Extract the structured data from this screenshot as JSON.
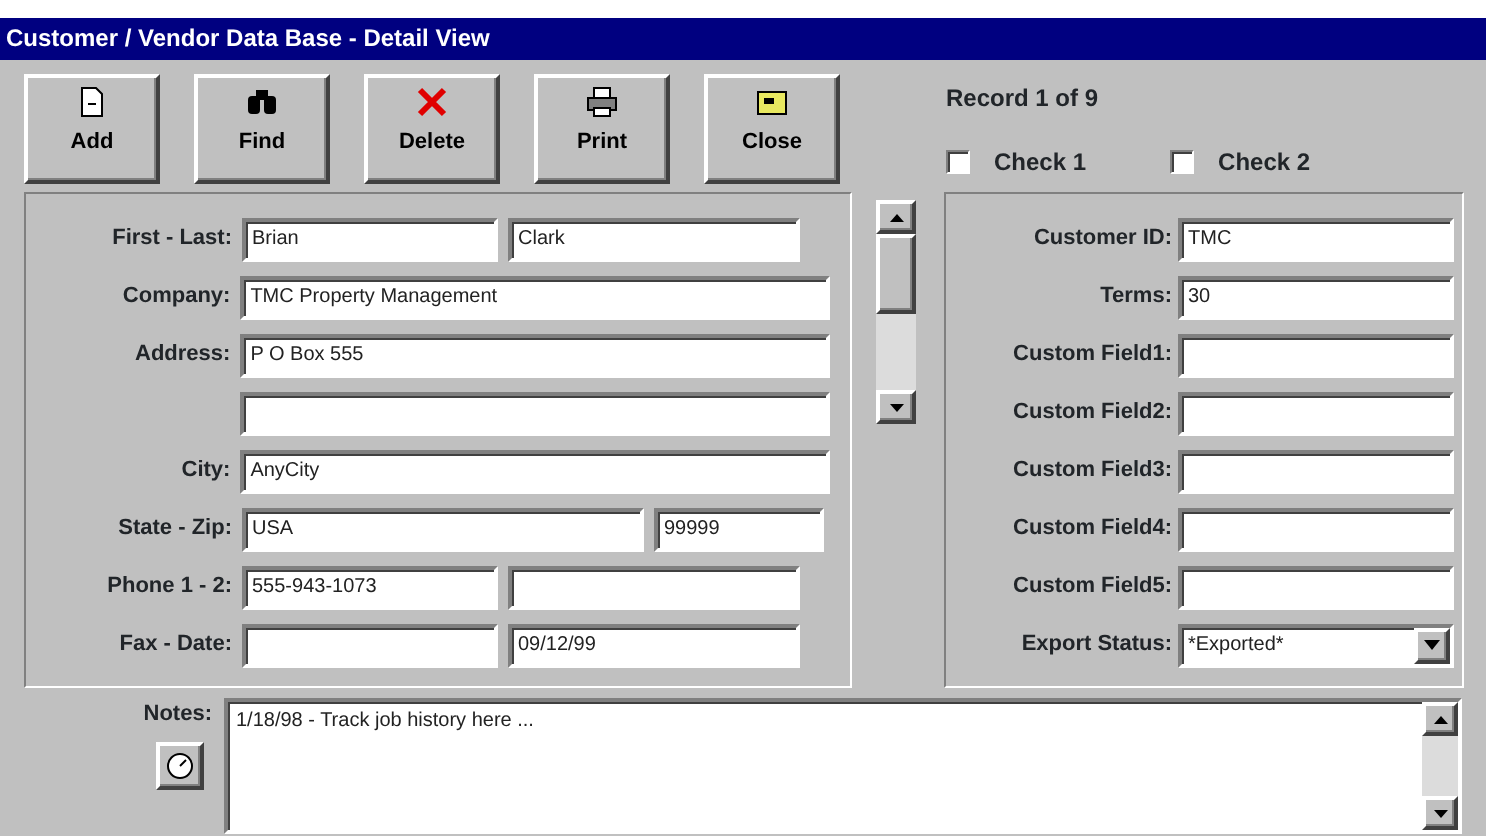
{
  "window": {
    "title": "Customer / Vendor Data Base - Detail View"
  },
  "toolbar": [
    {
      "label": "Add"
    },
    {
      "label": "Find"
    },
    {
      "label": "Delete"
    },
    {
      "label": "Print"
    },
    {
      "label": "Close"
    }
  ],
  "record": "Record 1 of 9",
  "checks": [
    {
      "label": "Check 1",
      "checked": false
    },
    {
      "label": "Check 2",
      "checked": false
    }
  ],
  "contact_fields": [
    {
      "label": "First - Last:",
      "kind": "pair",
      "fields": [
        {
          "kind": "text",
          "value": "Brian"
        },
        {
          "kind": "text",
          "value": "Clark"
        }
      ]
    },
    {
      "label": "Company:",
      "kind": "single",
      "fields": [
        {
          "kind": "text",
          "value": "TMC Property Management"
        }
      ]
    },
    {
      "label": "Address:",
      "kind": "single",
      "fields": [
        {
          "kind": "text",
          "value": "P O Box 555"
        }
      ]
    },
    {
      "kind": "single",
      "fields": [
        {
          "kind": "text"
        }
      ]
    },
    {
      "label": "City:",
      "kind": "single",
      "fields": [
        {
          "kind": "text",
          "value": "AnyCity"
        }
      ]
    },
    {
      "label": "State - Zip:",
      "kind": "wide_pair",
      "fields": [
        {
          "kind": "text",
          "value": "USA"
        },
        {
          "kind": "text",
          "value": "99999"
        }
      ]
    },
    {
      "label": "Phone 1 - 2:",
      "kind": "pair",
      "fields": [
        {
          "kind": "text",
          "value": "555-943-1073"
        },
        {
          "kind": "text"
        }
      ]
    },
    {
      "label": "Fax - Date:",
      "kind": "pair",
      "fields": [
        {
          "kind": "text"
        },
        {
          "kind": "text",
          "value": "09/12/99"
        }
      ]
    }
  ],
  "account_fields": [
    {
      "label": "Customer ID:",
      "value": "TMC",
      "kind": "text"
    },
    {
      "label": "Terms:",
      "value": "30",
      "kind": "text"
    },
    {
      "label": "Custom Field1:",
      "kind": "text"
    },
    {
      "label": "Custom Field2:",
      "kind": "text"
    },
    {
      "label": "Custom Field3:",
      "kind": "text"
    },
    {
      "label": "Custom Field4:",
      "kind": "text"
    },
    {
      "label": "Custom Field5:",
      "kind": "text"
    },
    {
      "label": "Export Status:",
      "value": "*Exported*",
      "kind": "dropdown"
    }
  ],
  "notes": {
    "label": "Notes:",
    "value": "1/18/98 - Track job history here ..."
  }
}
